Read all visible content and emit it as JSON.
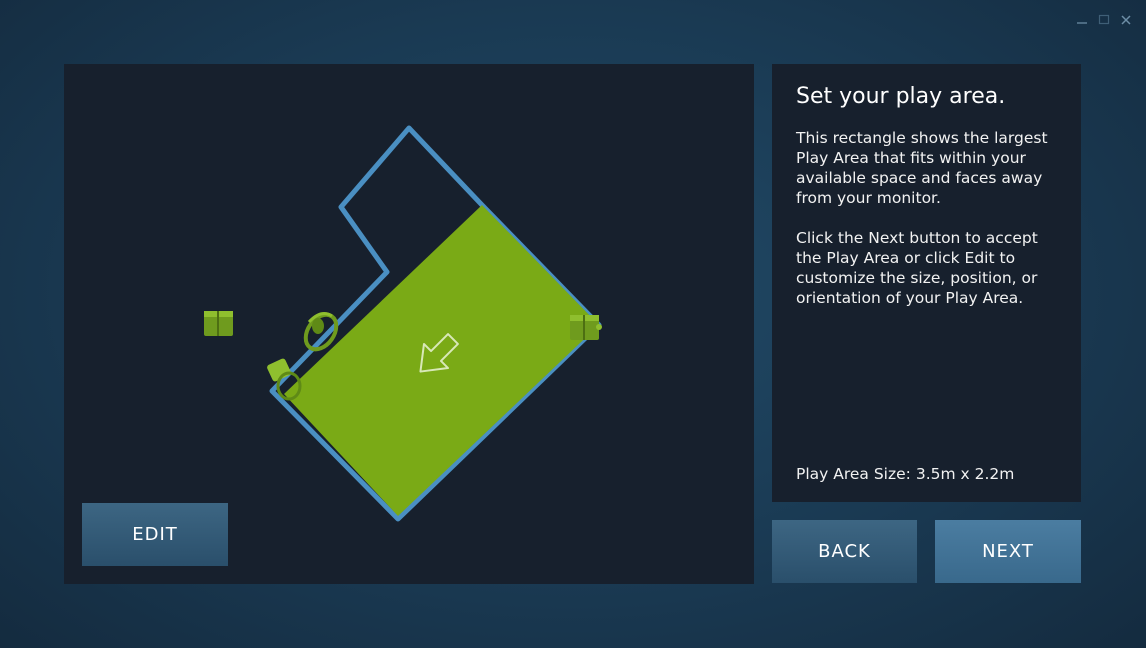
{
  "window_controls": {
    "minimize_icon": "minimize-icon",
    "maximize_icon": "maximize-icon",
    "close_icon": "close-icon"
  },
  "viewport": {
    "edit_label": "EDIT",
    "icons": [
      "direction-arrow-icon",
      "headset-icon",
      "controller-icon",
      "base-station-icon"
    ],
    "colors": {
      "background": "#17202d",
      "boundary": "#4a8fc2",
      "play_area": "#7aaa16",
      "arrow": "#d8e8b8"
    }
  },
  "info": {
    "title": "Set your play area.",
    "paragraph_1_lines": [
      "This rectangle shows the largest",
      "Play Area that fits within your",
      "available space and faces away",
      "from your monitor."
    ],
    "paragraph_2_lines": [
      "Click the Next button to accept",
      "the Play Area or click Edit to",
      "customize the size, position, or",
      "orientation of your Play Area."
    ],
    "size_label": "Play Area Size:",
    "size_value": "3.5m x 2.2m"
  },
  "nav": {
    "back_label": "BACK",
    "next_label": "NEXT"
  }
}
